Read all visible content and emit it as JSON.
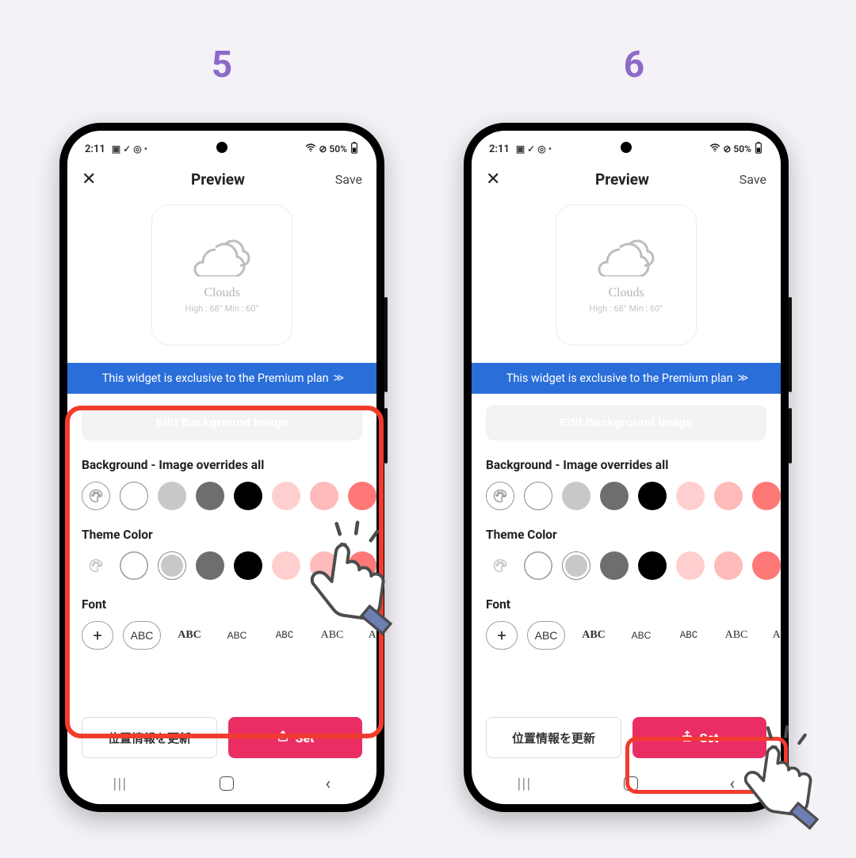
{
  "steps": {
    "left": "5",
    "right": "6"
  },
  "status": {
    "time": "2:11",
    "battery": "50%",
    "battery_icon_glyph": "▯",
    "icons_left": [
      "image-icon",
      "check-icon",
      "target-icon",
      "more-icon"
    ],
    "icons_right": [
      "wifi-icon",
      "no-signal-icon"
    ]
  },
  "appbar": {
    "close_glyph": "✕",
    "title": "Preview",
    "save": "Save"
  },
  "preview": {
    "label": "Clouds",
    "temps": "High : 68° Min : 60°"
  },
  "banner": "This widget is exclusive to the Premium plan",
  "editor": {
    "edit_bg": "Edit Background Image",
    "section_bg": "Background - Image overrides all",
    "section_theme": "Theme Color",
    "section_font": "Font",
    "bg_colors": [
      "picker",
      "#FFFFFF",
      "#C8C8C8",
      "#6E6E6E",
      "#000000",
      "#FFCFCF",
      "#FFBABA",
      "#FF7878"
    ],
    "bg_selected_index": 1,
    "theme_colors": [
      "picker",
      "#FFFFFF",
      "#C8C8C8",
      "#6E6E6E",
      "#000000",
      "#FFCFCF",
      "#FFBABA",
      "#FF7878"
    ],
    "theme_selected_index": 2,
    "fonts": [
      {
        "label": "+",
        "family": "inherit",
        "weight": "400",
        "pill": true,
        "plus": true
      },
      {
        "label": "ABC",
        "family": "Helvetica, Arial, sans-serif",
        "weight": "400",
        "pill": true
      },
      {
        "label": "ABC",
        "family": "Georgia, 'Times New Roman', serif",
        "weight": "700",
        "pill": false
      },
      {
        "label": "ABC",
        "family": "'Arial Narrow', Arial, sans-serif",
        "weight": "400",
        "pill": false,
        "size": "12px"
      },
      {
        "label": "ABC",
        "family": "'Courier New', monospace",
        "weight": "400",
        "pill": false,
        "size": "12.5px"
      },
      {
        "label": "ABC",
        "family": "'Palatino Linotype', Georgia, serif",
        "weight": "400",
        "pill": false
      },
      {
        "label": "ABC",
        "family": "'Times New Roman', serif",
        "weight": "400",
        "pill": false
      }
    ]
  },
  "actions": {
    "update_location": "位置情報を更新",
    "set": "Set"
  },
  "nav": {
    "recent": "|||",
    "back": "‹"
  }
}
